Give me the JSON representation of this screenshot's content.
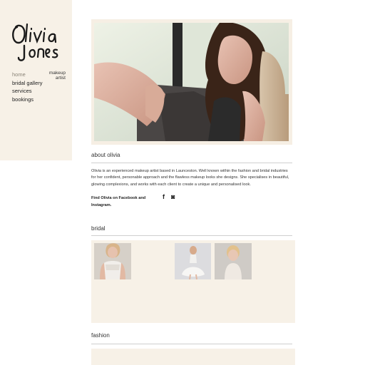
{
  "logo": {
    "script_text": "Olivia Jones",
    "subtitle_line1": "makeup",
    "subtitle_line2": "artist"
  },
  "nav": {
    "items": [
      {
        "label": "home",
        "active": true
      },
      {
        "label": "bridal gallery",
        "active": false
      },
      {
        "label": "services",
        "active": false
      },
      {
        "label": "bookings",
        "active": false
      }
    ]
  },
  "hero": {
    "image": "woman-in-car-photo"
  },
  "about": {
    "title": "about olivia",
    "body": "Olivia is an experienced makeup artist based in Launceston. Well known within the fashion and bridal industries for her confident, personable approach and the flawless makeup looks she designs. She specialises in beautiful, glowing complexions, and works with each client to create a unique and personalised look.",
    "find_text": "Find Olivia on Facebook and Instagram.",
    "facebook_icon": "f",
    "instagram_icon": "◙"
  },
  "bridal": {
    "title": "bridal",
    "images": [
      "bride-lace-dress-photo",
      "bride-tulle-skirt-photo",
      "bride-updo-photo"
    ]
  },
  "fashion": {
    "title": "fashion"
  },
  "colors": {
    "accent_bg": "#f7f1e7",
    "rule": "#cfcfcf",
    "nav_active": "#8a8377"
  }
}
